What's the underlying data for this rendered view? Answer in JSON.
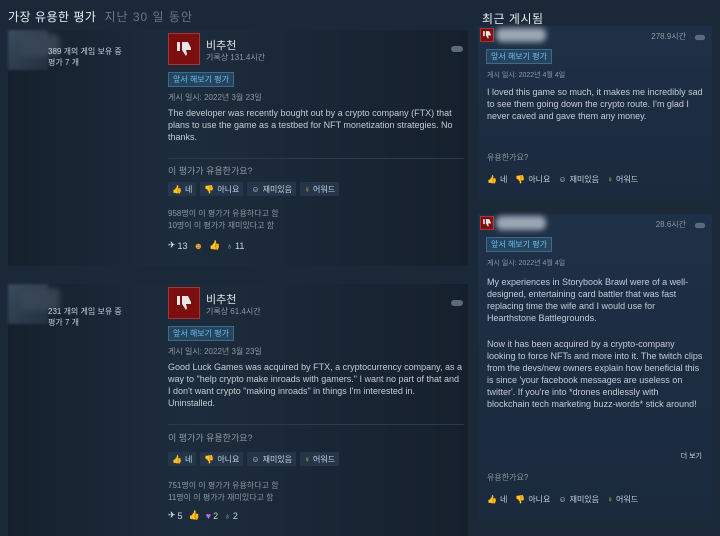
{
  "header": {
    "title": "가장 유용한 평가",
    "subtitle": "지난 30 일 동안",
    "right_title": "최근 게시됨"
  },
  "colors": {
    "background": "#1b2838",
    "not_recommended": "#7b0f0f",
    "accent_blue": "#66c0f4"
  },
  "reviews": [
    {
      "owned": "389 개의 게임 보유 중",
      "review_count": "평가 7 개",
      "verdict": "비추천",
      "hours": "기록상 131.4시간",
      "badge": "앞서 해보기 평가",
      "posted": "게시 일시: 2022년 3월 23일",
      "text": "The developer was recently bought out by a crypto company (FTX) that plans to use the game as a testbed for NFT monetization strategies. No thanks.",
      "helpful_q": "이 평가가 유용한가요?",
      "votes": {
        "yes": "네",
        "no": "아니요",
        "funny": "재미있음",
        "award": "어워드"
      },
      "stat_helpful": "958명이 이 평가가 유용하다고 함",
      "stat_funny": "10명이 이 평가가 재미있다고 함",
      "awards": [
        {
          "icon": "wings-award-icon",
          "count": "13"
        },
        {
          "icon": "hug-award-icon",
          "count": ""
        },
        {
          "icon": "thumbs-award-icon",
          "count": ""
        },
        {
          "icon": "medal-award-icon",
          "count": "11"
        }
      ]
    },
    {
      "owned": "231 개의 게임 보유 중",
      "review_count": "평가 7 개",
      "verdict": "비추천",
      "hours": "기록상 61.4시간",
      "badge": "앞서 해보기 평가",
      "posted": "게시 일시: 2022년 3월 23일",
      "text": "Good Luck Games was acquired by FTX, a cryptocurrency company, as a way to \"help crypto make inroads with gamers.\" I want no part of that and I don't want crypto \"making inroads\" in things I'm interested in. Uninstalled.",
      "helpful_q": "이 평가가 유용한가요?",
      "votes": {
        "yes": "네",
        "no": "아니요",
        "funny": "재미있음",
        "award": "어워드"
      },
      "stat_helpful": "751명이 이 평가가 유용하다고 함",
      "stat_funny": "11명이 이 평가가 재미있다고 함",
      "awards": [
        {
          "icon": "wings-award-icon",
          "count": "5"
        },
        {
          "icon": "thumbs-award-icon",
          "count": ""
        },
        {
          "icon": "heart-award-icon",
          "count": "2"
        },
        {
          "icon": "medal-award-icon",
          "count": "2"
        }
      ]
    }
  ],
  "recent": [
    {
      "hours": "278.9시간",
      "badge": "앞서 해보기 평가",
      "posted": "게시 일시: 2022년 4월 4일",
      "text": "I loved this game so much, it makes me incredibly sad to see them going down the crypto route. I'm glad I never caved and gave them any money.",
      "helpful_q": "유용한가요?",
      "votes": {
        "yes": "네",
        "no": "아니요",
        "funny": "재미있음",
        "award": "어워드"
      }
    },
    {
      "hours": "28.6시간",
      "badge": "앞서 해보기 평가",
      "posted": "게시 일시: 2022년 4월 4일",
      "text_p1": "My experiences in Storybook Brawl were of a well-designed, entertaining card battler that was fast replacing time the wife and I would use for Hearthstone Battlegrounds.",
      "text_p2": "Now it has been acquired by a crypto-company looking to force NFTs and more into it. The twitch clips from the devs/new owners explain how beneficial this is since 'your facebook messages are useless on twitter'. If you're into *drones endlessly with blockchain tech marketing buzz-words* stick around!",
      "more": "더 보기",
      "helpful_q": "유용한가요?",
      "votes": {
        "yes": "네",
        "no": "아니요",
        "funny": "재미있음",
        "award": "어워드"
      }
    }
  ]
}
